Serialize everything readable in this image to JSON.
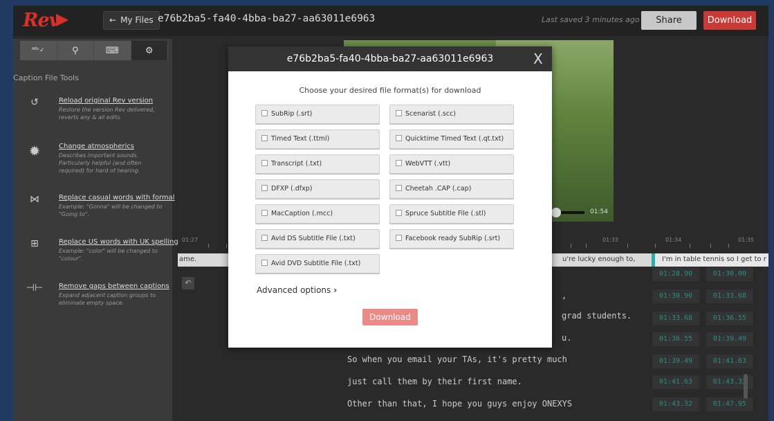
{
  "app": {
    "logo": "Rev",
    "my_files": "My Files",
    "file_title": "e76b2ba5-fa40-4bba-ba27-aa63011e6963",
    "saved_status": "Last saved 3 minutes ago",
    "share": "Share",
    "download": "Download"
  },
  "sidebar": {
    "tabs": [
      {
        "icon": "spellcheck-icon",
        "glyph": "ᴬᴮᶜ✓"
      },
      {
        "icon": "search-icon",
        "glyph": "⚲"
      },
      {
        "icon": "keyboard-icon",
        "glyph": "⌨"
      },
      {
        "icon": "gear-icon",
        "glyph": "⚙"
      }
    ],
    "heading": "Caption File Tools",
    "tools": [
      {
        "label": "Reload original Rev version",
        "desc": "Restore the version Rev delivered, reverts any & all edits.",
        "icon": "reload-icon",
        "glyph": "↺"
      },
      {
        "label": "Change atmospherics",
        "desc": "Describes important sounds. Particularly helpful (and often required) for hard of hearing.",
        "icon": "burst-icon",
        "glyph": "✹"
      },
      {
        "label": "Replace casual words with formal",
        "desc": "Example: \"Gonna\" will be changed to \"Going to\".",
        "icon": "bowtie-icon",
        "glyph": "⋈"
      },
      {
        "label": "Replace US words with UK spelling",
        "desc": "Example: \"color\" will be changed to \"colour\".",
        "icon": "uk-flag-icon",
        "glyph": "⊞"
      },
      {
        "label": "Remove gaps between captions",
        "desc": "Expand adjacent caption groups to eliminate empty space.",
        "icon": "gap-icon",
        "glyph": "⊣⊢"
      }
    ]
  },
  "player": {
    "time": "01:54"
  },
  "timeline": {
    "ticks": [
      "01:27",
      "01:33",
      "01:34",
      "01:35"
    ],
    "caption_left": "ame.",
    "caption_mid": "u're lucky enough to,",
    "caption_right": "I'm in table tennis so I get to r"
  },
  "transcript": {
    "lines": [
      ",",
      "grad students.",
      "u.",
      "So when you email your TAs, it's pretty much",
      "just call them by their first name.",
      "Other than that, I hope you guys enjoy ONEXYS"
    ],
    "timecodes": [
      [
        "01:28.90",
        "01:30.00"
      ],
      [
        "01:30.90",
        "01:33.68"
      ],
      [
        "01:33.68",
        "01:36.55"
      ],
      [
        "01:36.55",
        "01:39.49"
      ],
      [
        "01:39.49",
        "01:41.63"
      ],
      [
        "01:41.63",
        "01:43.32"
      ],
      [
        "01:43.32",
        "01:47.95"
      ]
    ]
  },
  "modal": {
    "title": "e76b2ba5-fa40-4bba-ba27-aa63011e6963",
    "close": "X",
    "subtitle": "Choose your desired file format(s) for download",
    "formats": [
      "SubRip (.srt)",
      "Scenarist (.scc)",
      "Timed Text (.ttml)",
      "Quicktime Timed Text (.qt.txt)",
      "Transcript (.txt)",
      "WebVTT (.vtt)",
      "DFXP (.dfxp)",
      "Cheetah .CAP (.cap)",
      "MacCaption (.mcc)",
      "Spruce Subtitle File (.stl)",
      "Avid DS Subtitle File (.txt)",
      "Facebook ready SubRip (.srt)",
      "Avid DVD Subtitle File (.txt)"
    ],
    "advanced": "Advanced options",
    "download": "Download"
  }
}
